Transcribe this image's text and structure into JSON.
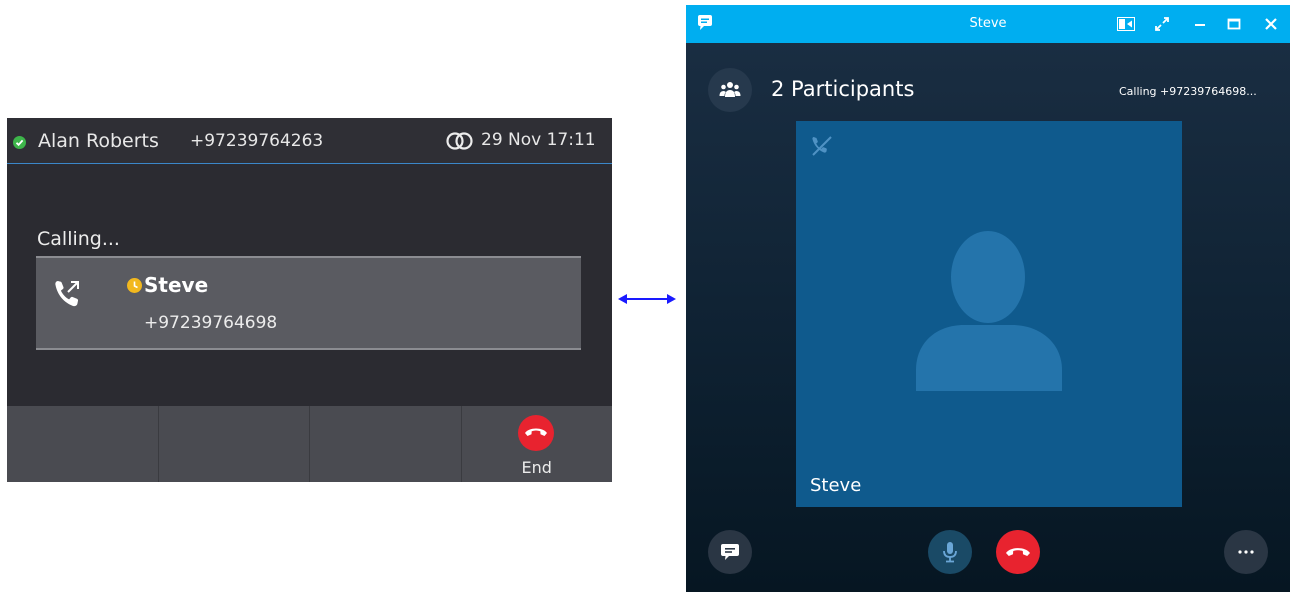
{
  "phone": {
    "user_name": "Alan Roberts",
    "extension": "+97239764263",
    "date_time": "29 Nov 17:11",
    "status_color": "#3db54a",
    "call_state": "Calling...",
    "contact": {
      "name": "Steve",
      "number": "+97239764698",
      "presence_color": "#f2b81e",
      "icon": "outgoing-call-icon"
    },
    "softkeys": [
      {
        "label": ""
      },
      {
        "label": ""
      },
      {
        "label": ""
      },
      {
        "label": "End",
        "icon": "hang-up-icon",
        "color": "#e8232f"
      }
    ]
  },
  "link_arrow": "bidirectional-arrow-icon",
  "call_window": {
    "title": "Steve",
    "title_bar_color": "#00aef0",
    "window_controls": [
      "layout-icon",
      "fullscreen-icon",
      "minimize-icon",
      "maximize-icon",
      "close-icon"
    ],
    "participants_label": "2 Participants",
    "calling_status": "Calling +97239764698...",
    "tile_name": "Steve",
    "tile_color": "#0f5a8d",
    "controls": [
      "chat-icon",
      "microphone-icon",
      "hang-up-icon",
      "more-options-icon"
    ]
  }
}
